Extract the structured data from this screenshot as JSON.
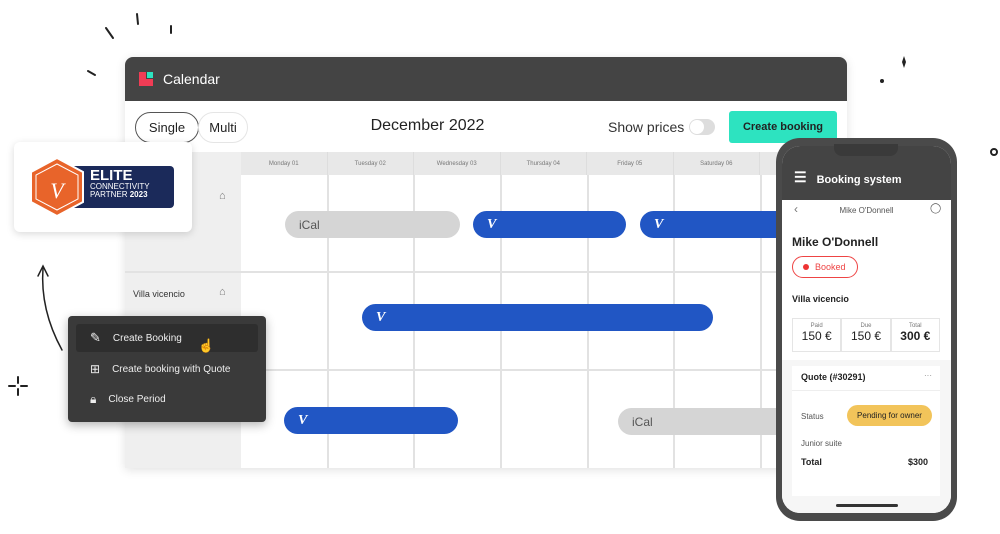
{
  "window": {
    "title": "Calendar"
  },
  "toolbar": {
    "single": "Single",
    "multi": "Multi",
    "month": "December 2022",
    "show_prices": "Show prices",
    "show_prices_on": false,
    "create_booking": "Create booking"
  },
  "days": [
    "Monday 01",
    "Tuesday 02",
    "Wednesday 03",
    "Thursday 04",
    "Friday 05",
    "Saturday 06"
  ],
  "rows": [
    {
      "name": ""
    },
    {
      "name": "Villa vicencio"
    },
    {
      "name": ""
    }
  ],
  "bookings": {
    "ical": "iCal",
    "vrbo": "V"
  },
  "badge": {
    "line1": "ELITE",
    "line2": "CONNECTIVITY",
    "line3": "PARTNER",
    "year": "2023"
  },
  "context_menu": {
    "items": [
      {
        "label": "Create Booking",
        "icon": "pencil-icon"
      },
      {
        "label": "Create booking with Quote",
        "icon": "quote-add-icon"
      },
      {
        "label": "Close Period",
        "icon": "lock-icon"
      }
    ]
  },
  "phone": {
    "app_title": "Booking system",
    "nav_title": "Mike O'Donnell",
    "guest": "Mike O'Donnell",
    "status": "Booked",
    "property": "Villa vicencio",
    "amounts": [
      {
        "label": "Paid",
        "value": "150 €"
      },
      {
        "label": "Due",
        "value": "150 €"
      },
      {
        "label": "Total",
        "value": "300 €"
      }
    ],
    "quote": {
      "title": "Quote (#30291)",
      "more": "···",
      "status_label": "Status",
      "status": "Pending for owner",
      "room": "Junior suite",
      "total_label": "Total",
      "total": "$300"
    }
  },
  "colors": {
    "accent": "#2de3c0",
    "brand_red": "#f03c55",
    "booking_blue": "#2156c4",
    "pending": "#f2c45a"
  }
}
